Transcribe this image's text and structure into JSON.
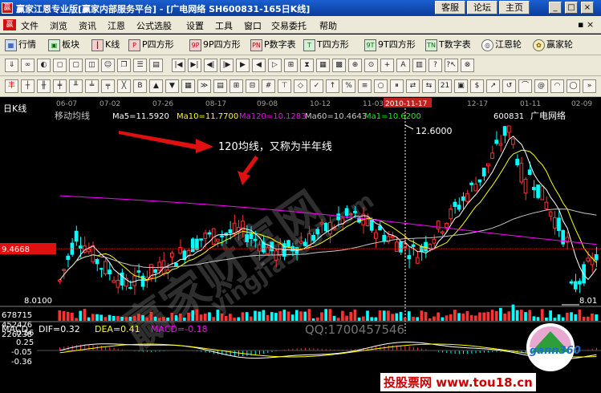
{
  "window": {
    "title": "赢家江恩专业版[赢家内部服务平台] - [广电网络    SH600831-165日K线]",
    "app_icon": "赢",
    "top_buttons": [
      "客服",
      "论坛",
      "主页"
    ]
  },
  "menu": [
    "文件",
    "浏览",
    "资讯",
    "江恩",
    "公式选股",
    "设置",
    "工具",
    "窗口",
    "交易委托",
    "帮助"
  ],
  "toolbar1": [
    {
      "icon": "table-icon",
      "label": "行情"
    },
    {
      "icon": "grid-icon",
      "label": "板块"
    },
    {
      "icon": "kline-icon",
      "label": "K线"
    },
    {
      "icon": "p4-icon",
      "label": "P四方形"
    },
    {
      "icon": "9p-icon",
      "label": "9P四方形"
    },
    {
      "icon": "pn-icon",
      "label": "P数字表"
    },
    {
      "icon": "t4-icon",
      "label": "T四方形"
    },
    {
      "icon": "9t-icon",
      "label": "9T四方形"
    },
    {
      "icon": "tn-icon",
      "label": "T数字表"
    },
    {
      "icon": "wheel-icon",
      "label": "江恩轮"
    },
    {
      "icon": "winner-icon",
      "label": "赢家轮"
    }
  ],
  "chart": {
    "period_label": "日K线",
    "indicator_label": "移动均线",
    "ma5": "Ma5=11.5920",
    "ma10": "Ma10=11.7700",
    "ma120": "Ma120=10.1283",
    "ma60": "Ma60=10.4643",
    "ma1": "Ma1=10.6200",
    "stock_code": "600831",
    "stock_name": "广电网络",
    "annotation": "120均线，又称为半年线",
    "high_label": "12.6000",
    "low_label_left": "8.0100",
    "low_label_right": "8.01",
    "price_tag": "9.4668",
    "date_axis": [
      "06-07",
      "07-02",
      "07-26",
      "08-17",
      "09-08",
      "10-12",
      "11-03",
      "2010-11-17",
      "12-17",
      "01-11",
      "02-09"
    ],
    "volume_labels": [
      "678715",
      "452476",
      "226238"
    ],
    "watermark_qq": "QQ:1700457546",
    "watermark_site": "yingjia360.com",
    "watermark_big": "赢家财富网"
  },
  "macd": {
    "label": "MACD",
    "dif": "DIF=0.32",
    "dea": "DEA=0.41",
    "macd": "MACD=-0.18",
    "scale": [
      "0.56",
      "0.25",
      "-0.05",
      "-0.36"
    ]
  },
  "footer_watermark": "投股票网  www.tou18.cn",
  "logo_text": "gann360",
  "colors": {
    "up": "#ff3232",
    "down": "#00ffff",
    "ma5": "#ffffff",
    "ma10": "#ffff00",
    "ma120": "#ff00ff",
    "ma60": "#c8c8c8"
  }
}
